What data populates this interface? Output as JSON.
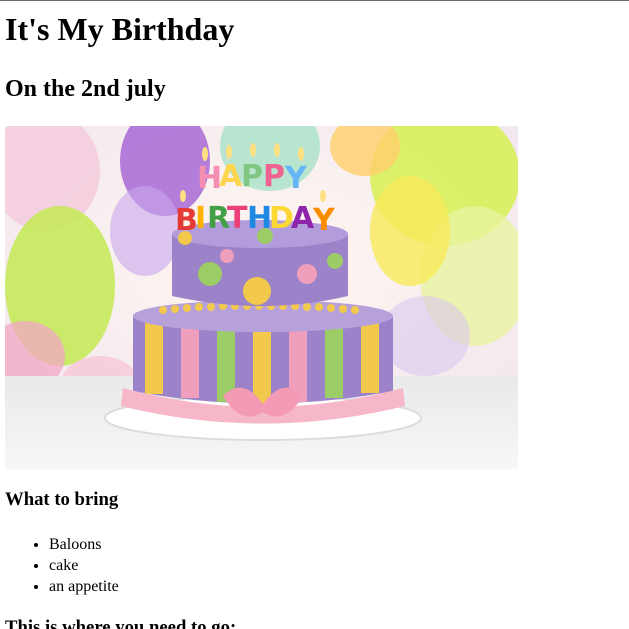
{
  "page": {
    "title": "It's My Birthday",
    "subtitle": "On the 2nd july",
    "image": {
      "description": "cake-image",
      "candle_text_top": "HAPPY",
      "candle_text_bottom": "BIRTHDAY"
    },
    "bring_heading": "What to bring",
    "bring_items": [
      "Baloons",
      "cake",
      "an appetite"
    ],
    "where_heading": "This is where you need to go:"
  },
  "colors": {
    "text": "#000000",
    "background": "#ffffff",
    "cake_purple": "#9b82c9",
    "cake_yellow": "#f2c94c",
    "cake_green": "#9ccc65",
    "ribbon_pink": "#f6b7c8"
  }
}
